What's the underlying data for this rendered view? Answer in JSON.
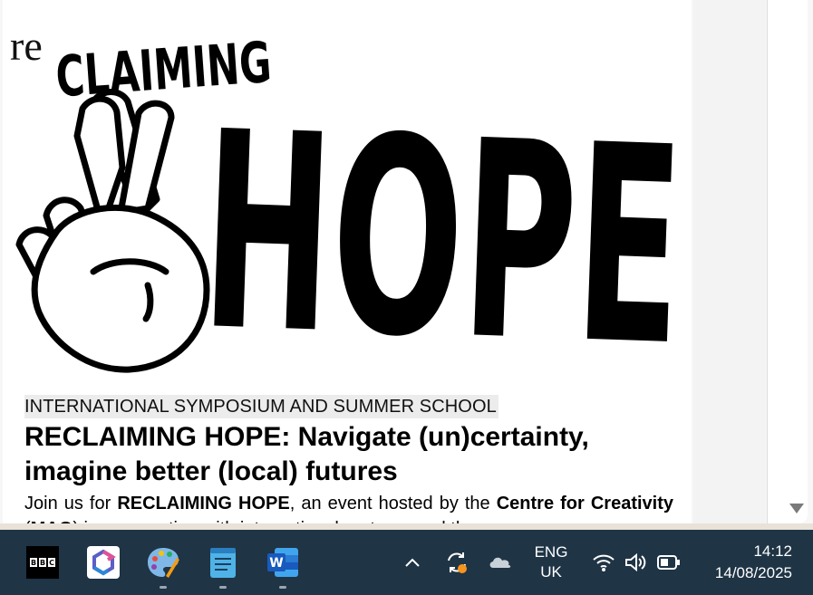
{
  "hero": {
    "prefix": "re",
    "word1": "CLAIMING",
    "word2": "HOPE"
  },
  "article": {
    "eyebrow": "INTERNATIONAL SYMPOSIUM AND SUMMER SCHOOL",
    "headline": "RECLAIMING HOPE: Navigate (un)certainty, imagine better (local) futures",
    "intro_start": "Join us for ",
    "event_name": "RECLAIMING HOPE",
    "intro_mid": ", an event hosted by the ",
    "host_name": "Centre for Creativity",
    "intro_paren_open": " (",
    "host_abbr": "MAO",
    "intro_end": ") in cooperation with international partners and the"
  },
  "taskbar": {
    "apps": [
      {
        "name": "BBC",
        "label": "BBC"
      },
      {
        "name": "Microsoft 365 Copilot",
        "label": ""
      },
      {
        "name": "Paint",
        "label": ""
      },
      {
        "name": "Notepad",
        "label": ""
      },
      {
        "name": "Word",
        "label": "W"
      }
    ],
    "tray": {
      "language_line1": "ENG",
      "language_line2": "UK",
      "time": "14:12",
      "date": "14/08/2025"
    }
  },
  "colors": {
    "taskbar_bg": "#1f3445",
    "word_blue": "#185abd",
    "sync_badge": "#f7941d"
  }
}
